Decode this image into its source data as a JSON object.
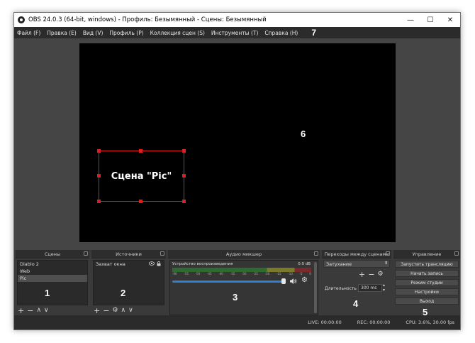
{
  "window": {
    "title": "OBS 24.0.3 (64-bit, windows) - Профиль: Безымянный - Сцены: Безымянный",
    "minimize": "—",
    "maximize": "☐",
    "close": "✕"
  },
  "menu": [
    "Файл (F)",
    "Правка (E)",
    "Вид (V)",
    "Профиль (P)",
    "Коллекция сцен (S)",
    "Инструменты (T)",
    "Справка (H)"
  ],
  "preview": {
    "source_label": "Сцена \"Pic\""
  },
  "annotations": [
    "1",
    "2",
    "3",
    "4",
    "5",
    "6",
    "7"
  ],
  "scenes": {
    "title": "Сцены",
    "items": [
      "Diablo 2",
      "Web",
      "Pic"
    ],
    "selected": "Pic"
  },
  "sources": {
    "title": "Источники",
    "items": [
      "Захват окна"
    ]
  },
  "mixer": {
    "title": "Аудио микшер",
    "device": "Устройство воспроизведения",
    "level": "0.0 dB",
    "scale": [
      "-60",
      "-55",
      "-50",
      "-45",
      "-40",
      "-35",
      "-30",
      "-25",
      "-20",
      "-15",
      "-10",
      "-5",
      "0"
    ]
  },
  "transitions": {
    "title": "Переходы между сценами",
    "selected": "Затухание",
    "duration_label": "Длительность",
    "duration_value": "300 ms"
  },
  "controls": {
    "title": "Управление",
    "buttons": [
      "Запустить трансляцию",
      "Начать запись",
      "Режим студии",
      "Настройки",
      "Выход"
    ]
  },
  "status": {
    "live": "LIVE: 00:00:00",
    "rec": "REC: 00:00:00",
    "cpu": "CPU: 3.6%, 30.00 fps"
  },
  "colors": {
    "selection": "#e21c1c",
    "panel": "#3a3a3a",
    "canvas": "#000000",
    "volume": "#2f7fd6"
  },
  "icons": [
    "obs-icon",
    "eye-icon",
    "lock-icon",
    "speaker-icon",
    "gear-icon",
    "plus-icon",
    "minus-icon",
    "up-icon",
    "down-icon"
  ]
}
